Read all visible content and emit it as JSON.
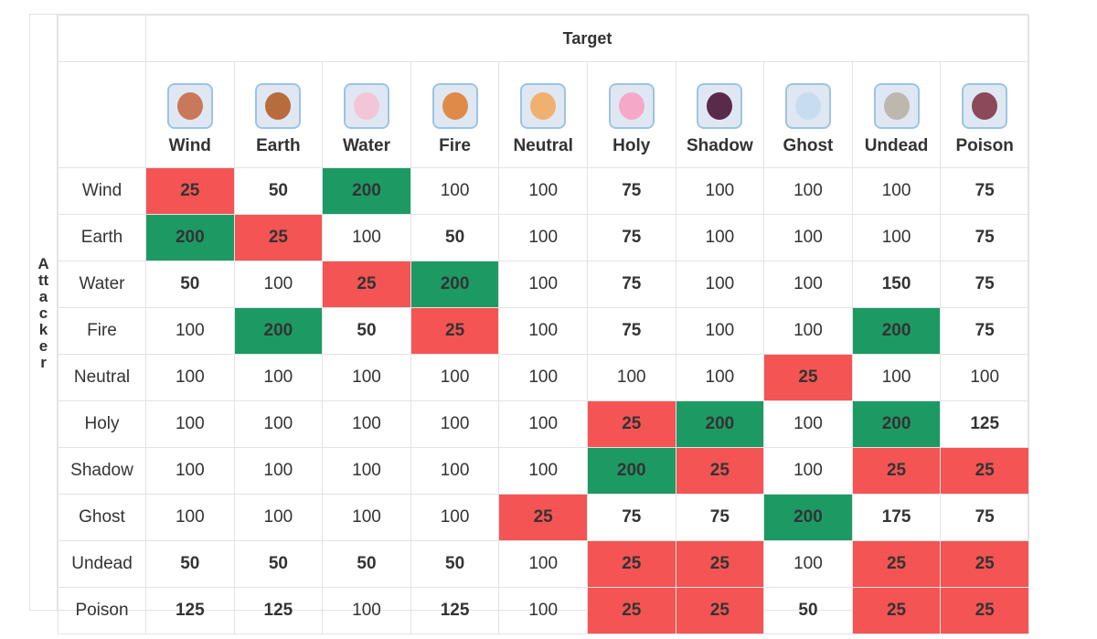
{
  "chart_data": {
    "type": "table",
    "column_axis_label": "Target",
    "row_axis_label": "Attacker",
    "columns": [
      {
        "label": "Wind",
        "icon": "wind-monster-icon",
        "color": "#c9785a"
      },
      {
        "label": "Earth",
        "icon": "earth-dwarf-icon",
        "color": "#b86b3c"
      },
      {
        "label": "Water",
        "icon": "water-jellyfish-icon",
        "color": "#f2c6d6"
      },
      {
        "label": "Fire",
        "icon": "fire-fox-icon",
        "color": "#e08a4a"
      },
      {
        "label": "Neutral",
        "icon": "neutral-egg-icon",
        "color": "#f0b070"
      },
      {
        "label": "Holy",
        "icon": "holy-angel-icon",
        "color": "#f6a8c8"
      },
      {
        "label": "Shadow",
        "icon": "shadow-demon-icon",
        "color": "#5a2a4a"
      },
      {
        "label": "Ghost",
        "icon": "ghost-icon",
        "color": "#c8dcf0"
      },
      {
        "label": "Undead",
        "icon": "undead-skeleton-icon",
        "color": "#bdb8ae"
      },
      {
        "label": "Poison",
        "icon": "poison-mushroom-icon",
        "color": "#8a4a5a"
      }
    ],
    "rows": [
      {
        "label": "Wind",
        "values": [
          25,
          50,
          200,
          100,
          100,
          75,
          100,
          100,
          100,
          75
        ]
      },
      {
        "label": "Earth",
        "values": [
          200,
          25,
          100,
          50,
          100,
          75,
          100,
          100,
          100,
          75
        ]
      },
      {
        "label": "Water",
        "values": [
          50,
          100,
          25,
          200,
          100,
          75,
          100,
          100,
          150,
          75
        ]
      },
      {
        "label": "Fire",
        "values": [
          100,
          200,
          50,
          25,
          100,
          75,
          100,
          100,
          200,
          75
        ]
      },
      {
        "label": "Neutral",
        "values": [
          100,
          100,
          100,
          100,
          100,
          100,
          100,
          25,
          100,
          100
        ]
      },
      {
        "label": "Holy",
        "values": [
          100,
          100,
          100,
          100,
          100,
          25,
          200,
          100,
          200,
          125
        ]
      },
      {
        "label": "Shadow",
        "values": [
          100,
          100,
          100,
          100,
          100,
          200,
          25,
          100,
          25,
          25
        ]
      },
      {
        "label": "Ghost",
        "values": [
          100,
          100,
          100,
          100,
          25,
          75,
          75,
          200,
          175,
          75
        ]
      },
      {
        "label": "Undead",
        "values": [
          50,
          50,
          50,
          50,
          100,
          25,
          25,
          100,
          25,
          25
        ]
      },
      {
        "label": "Poison",
        "values": [
          125,
          125,
          100,
          125,
          100,
          25,
          25,
          50,
          25,
          25
        ]
      }
    ],
    "colors": {
      "cell_red": "#f55454",
      "cell_green": "#1d9a64",
      "text_red": "#d0021b",
      "text_green": "#1a9a5a"
    }
  }
}
